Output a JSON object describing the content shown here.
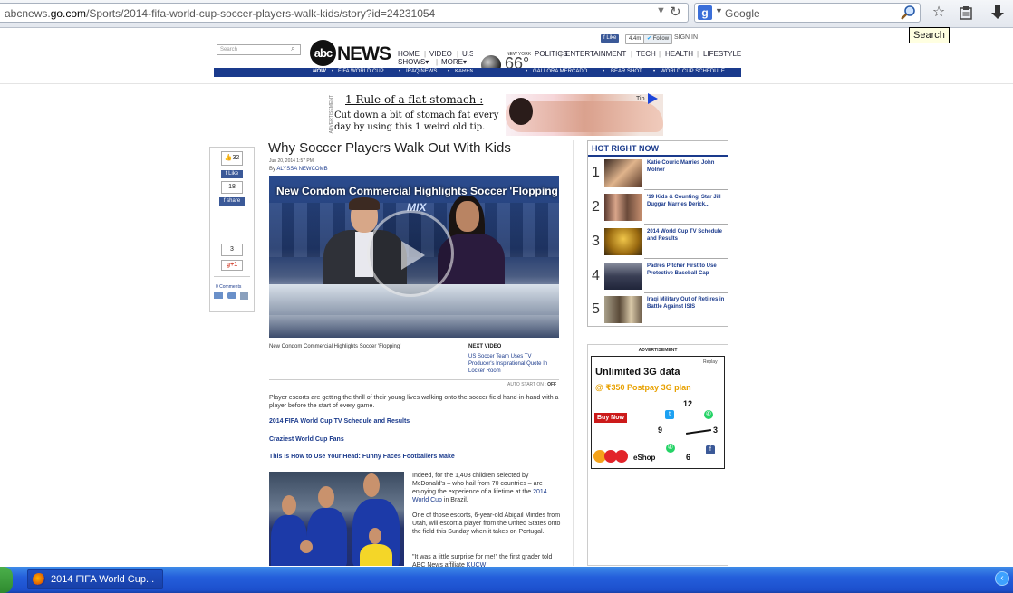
{
  "browser": {
    "url_prefix": "abcnews.",
    "url_domain": "go.com",
    "url_rest": "/Sports/2014-fifa-world-cup-soccer-players-walk-kids/story?id=24231054",
    "search_engine": "Google",
    "tooltip": "Search",
    "icons": [
      "dropdown-icon",
      "reload-icon",
      "google-icon",
      "magnifier-icon",
      "bookmark-star-icon",
      "clipboard-icon",
      "download-icon"
    ]
  },
  "header": {
    "search_placeholder": "Search",
    "logo_abc": "abc",
    "logo_news": "NEWS",
    "share": {
      "fb_like": "Like",
      "fb_count": "4.4m",
      "tw_follow": "Follow"
    },
    "signin": "SIGN IN",
    "nav": [
      "HOME",
      "VIDEO",
      "U.S.",
      "POLITICS",
      "ENTERTAINMENT",
      "TECH",
      "HEALTH",
      "LIFESTYLE"
    ],
    "nav2": [
      "SHOWS▾",
      "MORE▾"
    ],
    "weather": {
      "city": "NEW YORK",
      "temp": "66°"
    },
    "bluebar": [
      "NOW",
      "FIFA WORLD CUP",
      "IRAQ NEWS",
      "KAREN",
      "GALLORA MERCADO",
      "BEAR SHOT",
      "WORLD CUP SCHEDULE"
    ]
  },
  "top_ad": {
    "title": "1 Rule of a flat stomach :",
    "text": "Cut down a bit of stomach fat every day by using this 1 weird old tip.",
    "tip": "Tip",
    "side": "ADVERTISEMENT"
  },
  "social": {
    "thumb_count": "32",
    "fb_like": "Like",
    "fb_count": "18",
    "fb_share": "share",
    "gplus_count": "3",
    "gplus": "g+1",
    "comments": "0 Comments"
  },
  "article": {
    "title": "Why Soccer Players Walk Out With Kids",
    "date": "Jun 20, 2014 1:57 PM",
    "by": "By",
    "author": "ALYSSA NEWCOMB",
    "video_title": "New Condom Commercial Highlights Soccer 'Flopping",
    "video_brand": "MIX",
    "video_caption": "New Condom Commercial Highlights Soccer 'Flopping'",
    "next_label": "NEXT VIDEO",
    "next_title": "US Soccer Team Uses TV Producer's Inspirational Quote In Locker Room",
    "autostart": "AUTO START ON :",
    "autostart_state": "OFF",
    "lead": "Player escorts are getting the thrill of their young lives walking onto the soccer field hand-in-hand with a player before the start of every game.",
    "links": [
      "2014 FIFA World Cup TV Schedule and Results",
      "Craziest World Cup Fans",
      "This Is How to Use Your Head: Funny Faces Footballers Make"
    ],
    "para1a": "Indeed, for the 1,408 children selected by McDonald's – who hail from 70 countries – are enjoying the experience of a lifetime at the ",
    "para1_link": "2014 World Cup",
    "para1b": " in Brazil.",
    "para2": "One of those escorts, 6-year-old Abigail Mindes from Utah, will escort a player from the United States onto the field this Sunday when it takes on Portugal.",
    "para3a": "\"It was a little surprise for me!\" the first grader told ABC News affiliate ",
    "para3_link": "KUCW"
  },
  "hot": {
    "title": "HOT RIGHT NOW",
    "items": [
      {
        "num": "1",
        "text": "Katie Couric Marries John Molner"
      },
      {
        "num": "2",
        "text": "'19 Kids & Counting' Star Jill Duggar Marries Derick..."
      },
      {
        "num": "3",
        "text": "2014 World Cup TV Schedule and Results"
      },
      {
        "num": "4",
        "text": "Padres Pitcher First to Use Protective Baseball Cap"
      },
      {
        "num": "5",
        "text": "Iraqi Military Out of Retilres in Battle Against ISIS"
      }
    ]
  },
  "right_ad": {
    "label": "ADVERTISEMENT",
    "replay": "Replay",
    "title": "Unlimited 3G data",
    "offer": "@ ₹350 Postpay 3G plan",
    "buy": "Buy Now",
    "eshop": "eShop",
    "numbers": [
      "12",
      "9",
      "3",
      "6"
    ]
  },
  "taskbar": {
    "window_label": "2014 FIFA World Cup..."
  },
  "colors": {
    "abc_blue": "#1a3a8c",
    "taskbar": "#245edb",
    "fb": "#3b5998"
  }
}
